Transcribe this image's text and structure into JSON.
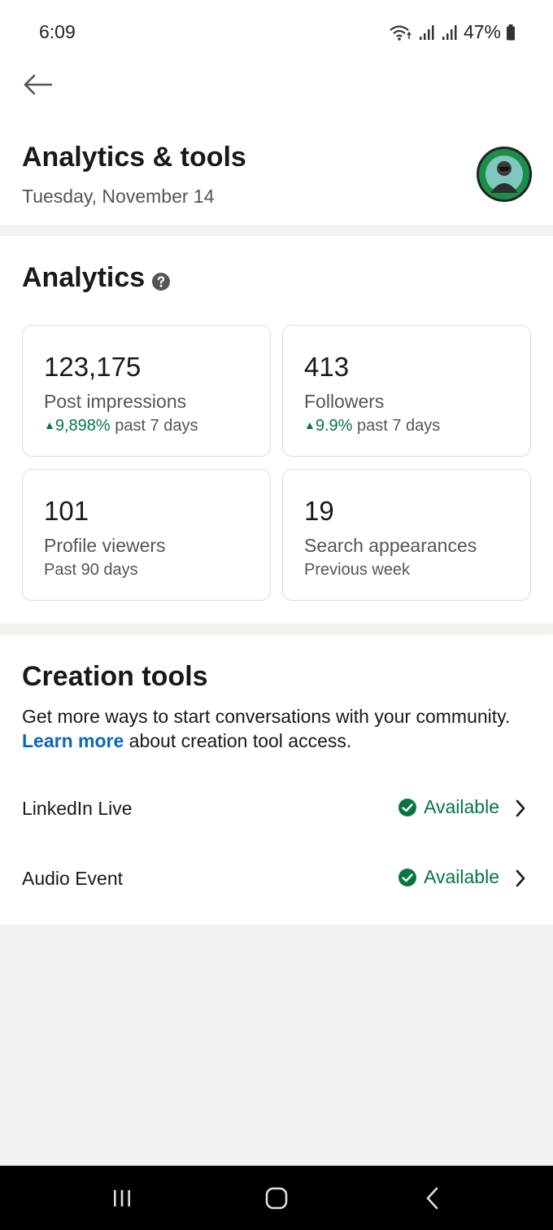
{
  "status_bar": {
    "time": "6:09",
    "battery": "47%",
    "icons": [
      "wifi-icon",
      "signal-icon",
      "signal-icon",
      "battery-icon"
    ]
  },
  "header": {
    "title": "Analytics & tools",
    "date": "Tuesday, November 14"
  },
  "analytics": {
    "title": "Analytics",
    "cards": [
      {
        "value": "123,175",
        "label": "Post impressions",
        "trend": "9,898%",
        "period": "past 7 days"
      },
      {
        "value": "413",
        "label": "Followers",
        "trend": "9.9%",
        "period": "past 7 days"
      },
      {
        "value": "101",
        "label": "Profile viewers",
        "period": "Past 90 days"
      },
      {
        "value": "19",
        "label": "Search appearances",
        "period": "Previous week"
      }
    ]
  },
  "creation": {
    "title": "Creation tools",
    "desc_before": "Get more ways to start conversations with your community.",
    "learn_more": "Learn more",
    "desc_after": "about creation tool access.",
    "tools": [
      {
        "label": "LinkedIn Live",
        "status": "Available"
      },
      {
        "label": "Audio Event",
        "status": "Available"
      }
    ]
  },
  "colors": {
    "accent": "#0a66c2",
    "positive": "#057642",
    "background": "#f3f2ef"
  }
}
